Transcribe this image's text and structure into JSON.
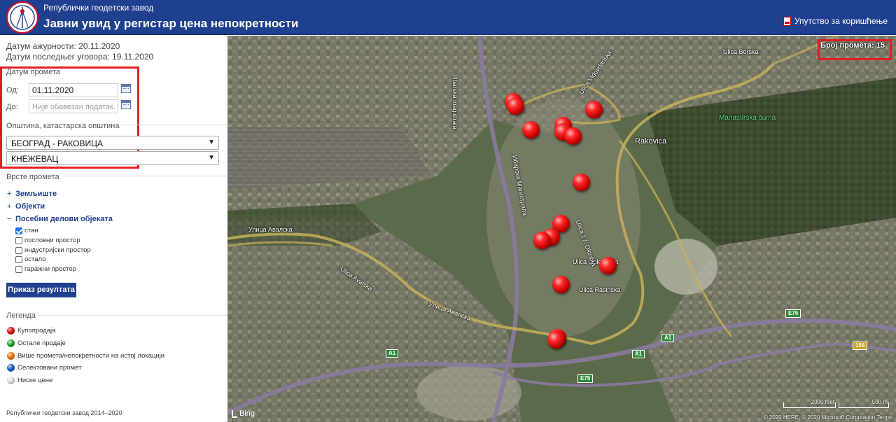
{
  "header": {
    "org_name": "Републички геодетски завод",
    "title": "Јавни увид у регистар цена непокретности",
    "manual_link": "Упутство за коришћење"
  },
  "sidebar": {
    "updated_label": "Датум ажурности: 20.11.2020",
    "last_contract_label": "Датум последњег уговора: 19.11.2020",
    "date_section": "Датум промета",
    "from_label": "Од:",
    "from_value": "01.11.2020",
    "to_label": "До:",
    "to_placeholder": "Није обавезан податак.",
    "municipality_section": "Општина, катастарска општина",
    "municipality_value": "БЕОГРАД - РАКОВИЦА",
    "cadastral_value": "КНЕЖЕВАЦ",
    "types_section": "Врсте промета",
    "types": [
      {
        "sign": "+",
        "label": "Земљиште"
      },
      {
        "sign": "+",
        "label": "Објекти"
      },
      {
        "sign": "−",
        "label": "Посебни делови објеката"
      }
    ],
    "subtypes": [
      {
        "label": "стан",
        "checked": true
      },
      {
        "label": "пословни простор",
        "checked": false
      },
      {
        "label": "индустријски простор",
        "checked": false
      },
      {
        "label": "остало",
        "checked": false
      },
      {
        "label": "гаражни простор",
        "checked": false
      }
    ],
    "results_button": "Приказ резултата",
    "legend_section": "Легенда",
    "legend": [
      {
        "label": "Купопродаја",
        "color": "#d91a1a"
      },
      {
        "label": "Остале продаје",
        "color": "#2fa52f"
      },
      {
        "label": "Више промета/непокретности на истој локацији",
        "color": "#f07818"
      },
      {
        "label": "Селектовани промет",
        "color": "#1d5fbf"
      },
      {
        "label": "Ниске цене",
        "color": "#d8d8d8"
      }
    ],
    "footer": "Републички геодетски завод 2014–2020"
  },
  "map": {
    "transaction_count": "Број промета: 15",
    "labels": {
      "rakovica": "Rakovica",
      "manastirska": "Manastirska šuma",
      "ulica_borska": "Ulica Borska",
      "ibarska": "Ibarska magistrala",
      "ibarska_cyr": "Ибарска Магистрала",
      "avalska_cyr": "Улица Авалска",
      "avalska_lat": "Ulica Avalska",
      "oplenacka": "Ulica Oplenačka",
      "rasinska": "Ulica Rasinska",
      "oktobra": "Ulica 17. Oktobra",
      "avalska_cyr2": "Улица Авалска",
      "vidovdanska": "Ulica Vidovdanska"
    },
    "road_shields": [
      "A1",
      "A1",
      "A1",
      "E75",
      "E75",
      "154"
    ],
    "bing": "Bing",
    "copyright": "© 2020 HERE, © 2020 Microsoft Corporation  Terms",
    "scale_ft": "2000 feet",
    "scale_m": "500 m"
  }
}
